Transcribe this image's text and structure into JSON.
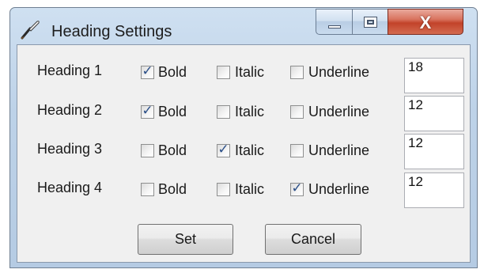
{
  "window": {
    "title": "Heading Settings",
    "controls": {
      "minimize": "minimize",
      "maximize": "maximize",
      "close_glyph": "X"
    }
  },
  "rows": [
    {
      "label": "Heading 1",
      "bold": true,
      "italic": false,
      "underline": false,
      "size": "18"
    },
    {
      "label": "Heading 2",
      "bold": true,
      "italic": false,
      "underline": false,
      "size": "12"
    },
    {
      "label": "Heading 3",
      "bold": false,
      "italic": true,
      "underline": false,
      "size": "12"
    },
    {
      "label": "Heading 4",
      "bold": false,
      "italic": false,
      "underline": true,
      "size": "12"
    }
  ],
  "labels": {
    "bold": "Bold",
    "italic": "Italic",
    "underline": "Underline"
  },
  "buttons": {
    "set": "Set",
    "cancel": "Cancel"
  },
  "colors": {
    "titlebar": "#bdd2e8",
    "close": "#c2432a",
    "client": "#f0f0f0",
    "check": "#2b4f88"
  }
}
